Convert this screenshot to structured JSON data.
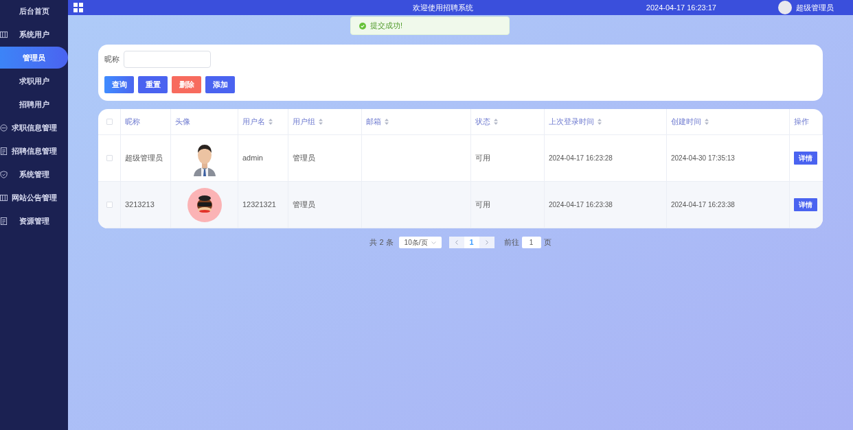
{
  "sidebar": {
    "items": [
      {
        "label": "后台首页",
        "selected": false
      },
      {
        "label": "系统用户",
        "selected": false
      },
      {
        "label": "管理员",
        "selected": true
      },
      {
        "label": "求职用户",
        "selected": false
      },
      {
        "label": "招聘用户",
        "selected": false
      },
      {
        "label": "求职信息管理",
        "selected": false
      },
      {
        "label": "招聘信息管理",
        "selected": false
      },
      {
        "label": "系统管理",
        "selected": false
      },
      {
        "label": "网站公告管理",
        "selected": false
      },
      {
        "label": "资源管理",
        "selected": false
      }
    ]
  },
  "header": {
    "title": "欢迎使用招聘系统",
    "datetime": "2024-04-17 16:23:17",
    "user": "超级管理员"
  },
  "toast": {
    "message": "提交成功!"
  },
  "search": {
    "label": "昵称",
    "buttons": [
      {
        "label": "查询",
        "kind": "query"
      },
      {
        "label": "重置",
        "kind": "reset"
      },
      {
        "label": "删除",
        "kind": "delete"
      },
      {
        "label": "添加",
        "kind": "add"
      }
    ]
  },
  "table": {
    "all_checked": false,
    "columns": [
      {
        "label": "昵称",
        "sortable": false
      },
      {
        "label": "头像",
        "sortable": false
      },
      {
        "label": "用户名",
        "sortable": true
      },
      {
        "label": "用户组",
        "sortable": true
      },
      {
        "label": "邮箱",
        "sortable": true
      },
      {
        "label": "状态",
        "sortable": true
      },
      {
        "label": "上次登录时间",
        "sortable": true
      },
      {
        "label": "创建时间",
        "sortable": true
      },
      {
        "label": "操作",
        "sortable": false
      }
    ],
    "rows": [
      {
        "checked": false,
        "nickname": "超级管理员",
        "username": "admin",
        "group": "管理员",
        "status": "可用",
        "last_login": "2024-04-17 16:23:28",
        "created": "2024-04-30 17:35:13",
        "action": "详情"
      },
      {
        "checked": false,
        "nickname": "3213213",
        "username": "12321321",
        "group": "管理员",
        "status": "可用",
        "last_login": "2024-04-17 16:23:38",
        "created": "2024-04-17 16:23:38",
        "action": "详情"
      }
    ]
  },
  "pagination": {
    "total": "共 2 条",
    "page_size": "10条/页",
    "page": "1",
    "goto_label": "前往",
    "goto_value": "1",
    "goto_suffix": "页"
  }
}
